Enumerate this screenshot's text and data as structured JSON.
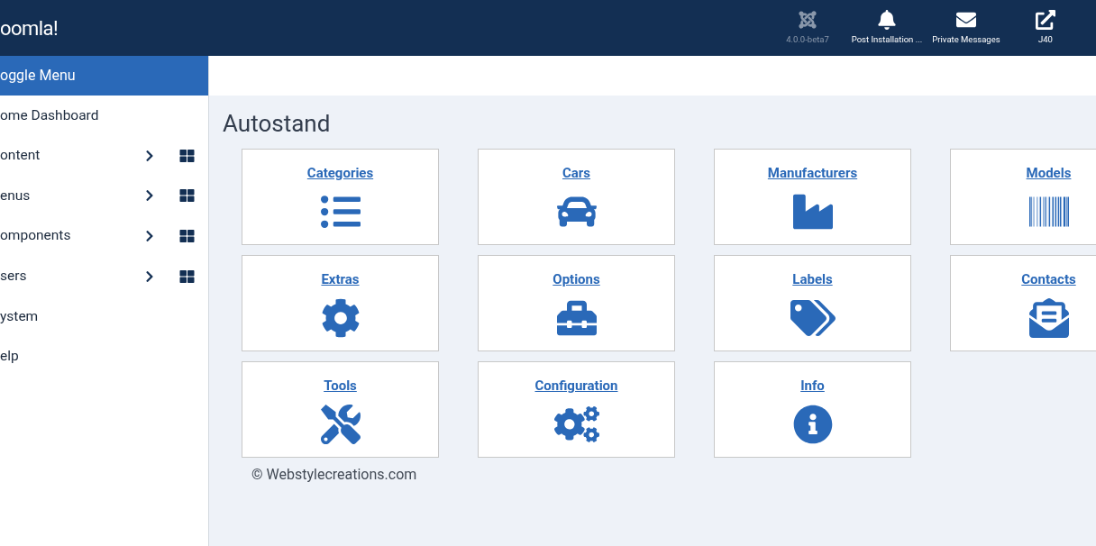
{
  "header": {
    "logo": "oomla!",
    "items": [
      {
        "label": "4.0.0-beta7",
        "disabled": true
      },
      {
        "label": "Post Installation ...",
        "disabled": false
      },
      {
        "label": "Private Messages",
        "disabled": false
      },
      {
        "label": "J40",
        "disabled": false
      }
    ]
  },
  "sidebar": {
    "toggle": "oggle Menu",
    "items": [
      {
        "label": "ome Dashboard",
        "kind": "link"
      },
      {
        "label": "ontent",
        "kind": "group"
      },
      {
        "label": "enus",
        "kind": "group"
      },
      {
        "label": "omponents",
        "kind": "group"
      },
      {
        "label": "sers",
        "kind": "group"
      },
      {
        "label": "ystem",
        "kind": "link"
      },
      {
        "label": "elp",
        "kind": "link"
      }
    ]
  },
  "page": {
    "title": "Autostand",
    "tiles": [
      {
        "label": "Categories"
      },
      {
        "label": "Cars"
      },
      {
        "label": "Manufacturers"
      },
      {
        "label": "Models"
      },
      {
        "label": "Extras"
      },
      {
        "label": "Options"
      },
      {
        "label": "Labels"
      },
      {
        "label": "Contacts"
      },
      {
        "label": "Tools"
      },
      {
        "label": "Configuration"
      },
      {
        "label": "Info"
      }
    ],
    "footer": "© Webstylecreations.com"
  }
}
